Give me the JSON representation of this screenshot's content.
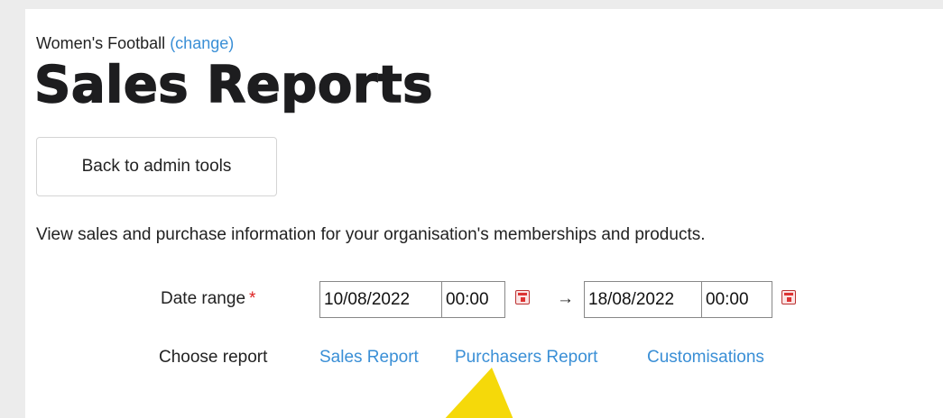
{
  "header": {
    "org_name": "Women's Football",
    "change_label": "(change)",
    "title": "Sales Reports"
  },
  "actions": {
    "back_label": "Back to admin tools"
  },
  "intro_text": "View sales and purchase information for your organisation's memberships and products.",
  "date_range": {
    "label": "Date range",
    "required_mark": "*",
    "start_date": "10/08/2022",
    "start_time": "00:00",
    "arrow": "→",
    "end_date": "18/08/2022",
    "end_time": "00:00"
  },
  "reports": {
    "label": "Choose report",
    "links": [
      "Sales Report",
      "Purchasers Report",
      "Customisations"
    ]
  },
  "colors": {
    "link": "#3a8fd6",
    "required": "#dd2222",
    "annotation_arrow": "#f5d90a"
  }
}
